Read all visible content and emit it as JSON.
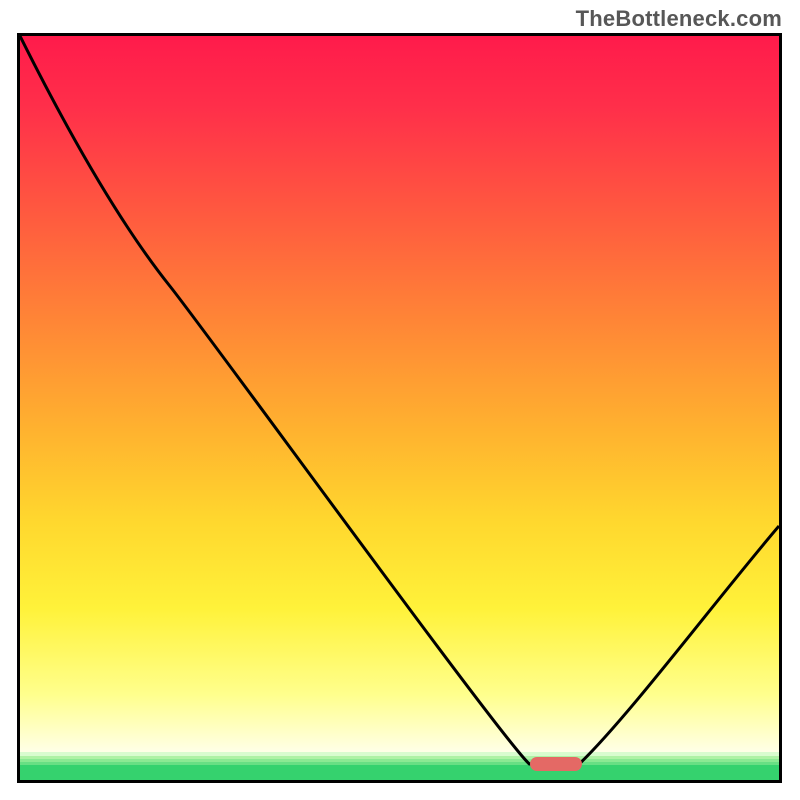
{
  "watermark": "TheBottleneck.com",
  "colors": {
    "frame_border": "#000000",
    "curve": "#000000",
    "marker": "#e46965",
    "gradient_top": "#ff1b4b",
    "gradient_mid": "#ffb22f",
    "gradient_low": "#ffff8d",
    "green_band": "#35d26e"
  },
  "chart_data": {
    "type": "line",
    "title": "",
    "xlabel": "",
    "ylabel": "",
    "xlim": [
      0,
      100
    ],
    "ylim": [
      0,
      100
    ],
    "grid": false,
    "legend": false,
    "series": [
      {
        "name": "bottleneck-curve",
        "x": [
          0,
          8,
          20,
          35,
          50,
          60,
          67,
          73,
          80,
          90,
          100
        ],
        "values": [
          100,
          84,
          66,
          45,
          25,
          11,
          3,
          3,
          10,
          22,
          35
        ]
      }
    ],
    "annotations": [
      {
        "name": "optimum-marker",
        "shape": "pill",
        "approx_x_range": [
          67,
          73
        ],
        "approx_y": 3,
        "color": "#e46965"
      }
    ],
    "background": {
      "style": "vertical-gradient",
      "stops": [
        {
          "offset": 0.0,
          "color": "#ff1b4b"
        },
        {
          "offset": 0.25,
          "color": "#ff5a3f"
        },
        {
          "offset": 0.55,
          "color": "#ffb22f"
        },
        {
          "offset": 0.8,
          "color": "#fff23a"
        },
        {
          "offset": 0.96,
          "color": "#ffffe7"
        },
        {
          "offset": 1.0,
          "color": "#35d26e"
        }
      ]
    }
  }
}
